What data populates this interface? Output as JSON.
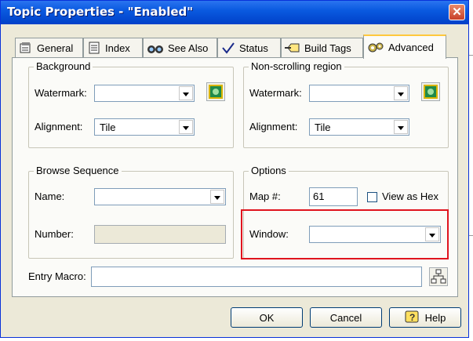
{
  "window": {
    "title": "Topic Properties - \"Enabled\""
  },
  "tabs": [
    {
      "label": "General",
      "icon": "properties-icon"
    },
    {
      "label": "Index",
      "icon": "index-icon"
    },
    {
      "label": "See Also",
      "icon": "binoculars-icon"
    },
    {
      "label": "Status",
      "icon": "checkmark-icon"
    },
    {
      "label": "Build Tags",
      "icon": "tag-arrow-icon"
    },
    {
      "label": "Advanced",
      "icon": "gears-icon",
      "active": true
    }
  ],
  "background": {
    "title": "Background",
    "watermark_label": "Watermark:",
    "watermark_value": "",
    "alignment_label": "Alignment:",
    "alignment_value": "Tile"
  },
  "nonscrolling": {
    "title": "Non-scrolling region",
    "watermark_label": "Watermark:",
    "watermark_value": "",
    "alignment_label": "Alignment:",
    "alignment_value": "Tile"
  },
  "browse": {
    "title": "Browse Sequence",
    "name_label": "Name:",
    "name_value": "",
    "number_label": "Number:",
    "number_value": ""
  },
  "options": {
    "title": "Options",
    "map_label": "Map #:",
    "map_value": "61",
    "hex_label": "View as Hex",
    "hex_checked": false,
    "window_label": "Window:",
    "window_value": ""
  },
  "entry_macro": {
    "label": "Entry Macro:",
    "value": ""
  },
  "buttons": {
    "ok": "OK",
    "cancel": "Cancel",
    "help": "Help"
  },
  "colors": {
    "titlebar": "#0a5ae0",
    "dialog_bg": "#ece9d8",
    "active_tab_accent": "#ffc83c",
    "highlight": "#e0141e"
  }
}
